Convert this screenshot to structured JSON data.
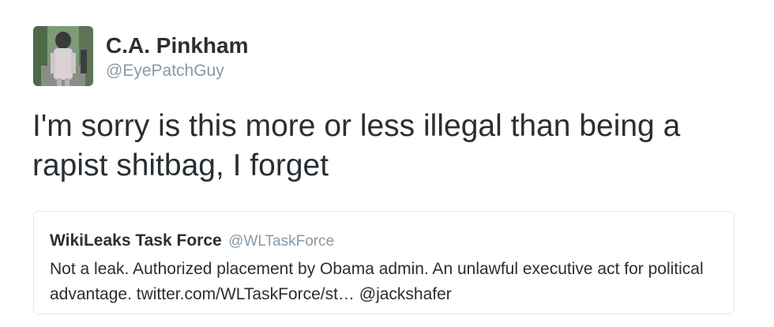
{
  "tweet": {
    "author": {
      "name": "C.A. Pinkham",
      "handle": "@EyePatchGuy",
      "avatar_icon": "profile-photo"
    },
    "text": "I'm sorry is this more or less illegal than being a rapist shitbag, I forget",
    "quoted_tweet": {
      "author_name": "WikiLeaks Task Force",
      "author_handle": "@WLTaskForce",
      "text": "Not a leak. Authorized placement by Obama admin. An unlawful executive act for political advantage. twitter.com/WLTaskForce/st… @jackshafer"
    }
  },
  "colors": {
    "text": "#292f33",
    "secondary_text": "#8899a6",
    "border": "#e1e8ed"
  }
}
